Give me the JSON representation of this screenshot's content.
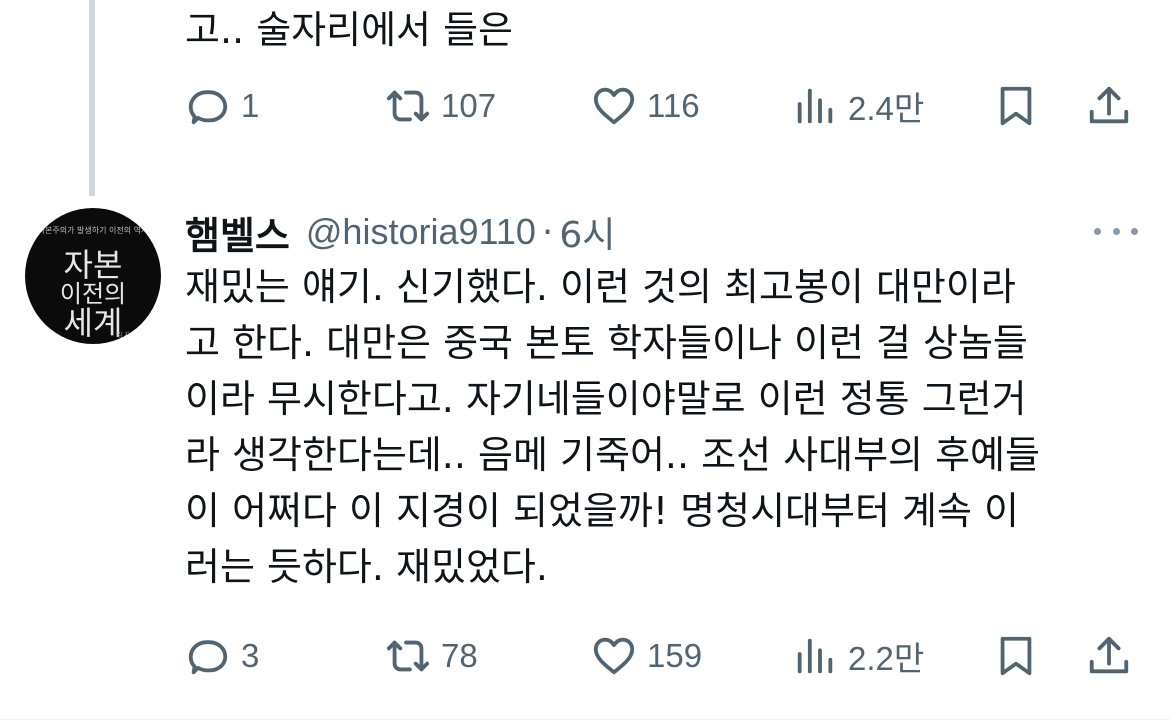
{
  "tweet1": {
    "text_tail": "고.. 술자리에서 들은",
    "actions": {
      "replies": "1",
      "retweets": "107",
      "likes": "116",
      "views": "2.4만"
    }
  },
  "tweet2": {
    "display_name": "햄벨스",
    "handle": "@historia9110",
    "separator": "·",
    "time": "6시",
    "avatar_cover": {
      "small_text": "자본주의가 발생하기 이전의 역사",
      "title_line1": "자본",
      "title_line2": "이전의",
      "title_line3": "세계",
      "author": "김 지음"
    },
    "text": "재밌는 얘기. 신기했다. 이런 것의 최고봉이 대만이라\n고 한다. 대만은 중국 본토 학자들이나 이런 걸 상놈들\n이라 무시한다고. 자기네들이야말로 이런 정통 그런거\n라 생각한다는데.. 음메 기죽어.. 조선 사대부의 후예들\n이 어쩌다 이 지경이 되었을까! 명청시대부터 계속 이\n러는 듯하다. 재밌었다.",
    "actions": {
      "replies": "3",
      "retweets": "78",
      "likes": "159",
      "views": "2.2만"
    }
  },
  "colors": {
    "text": "#0f1419",
    "secondary": "#536471",
    "thread_line": "#cfd9de"
  },
  "icons": [
    "reply-icon",
    "retweet-icon",
    "like-icon",
    "views-icon",
    "bookmark-icon",
    "share-icon",
    "more-icon"
  ]
}
